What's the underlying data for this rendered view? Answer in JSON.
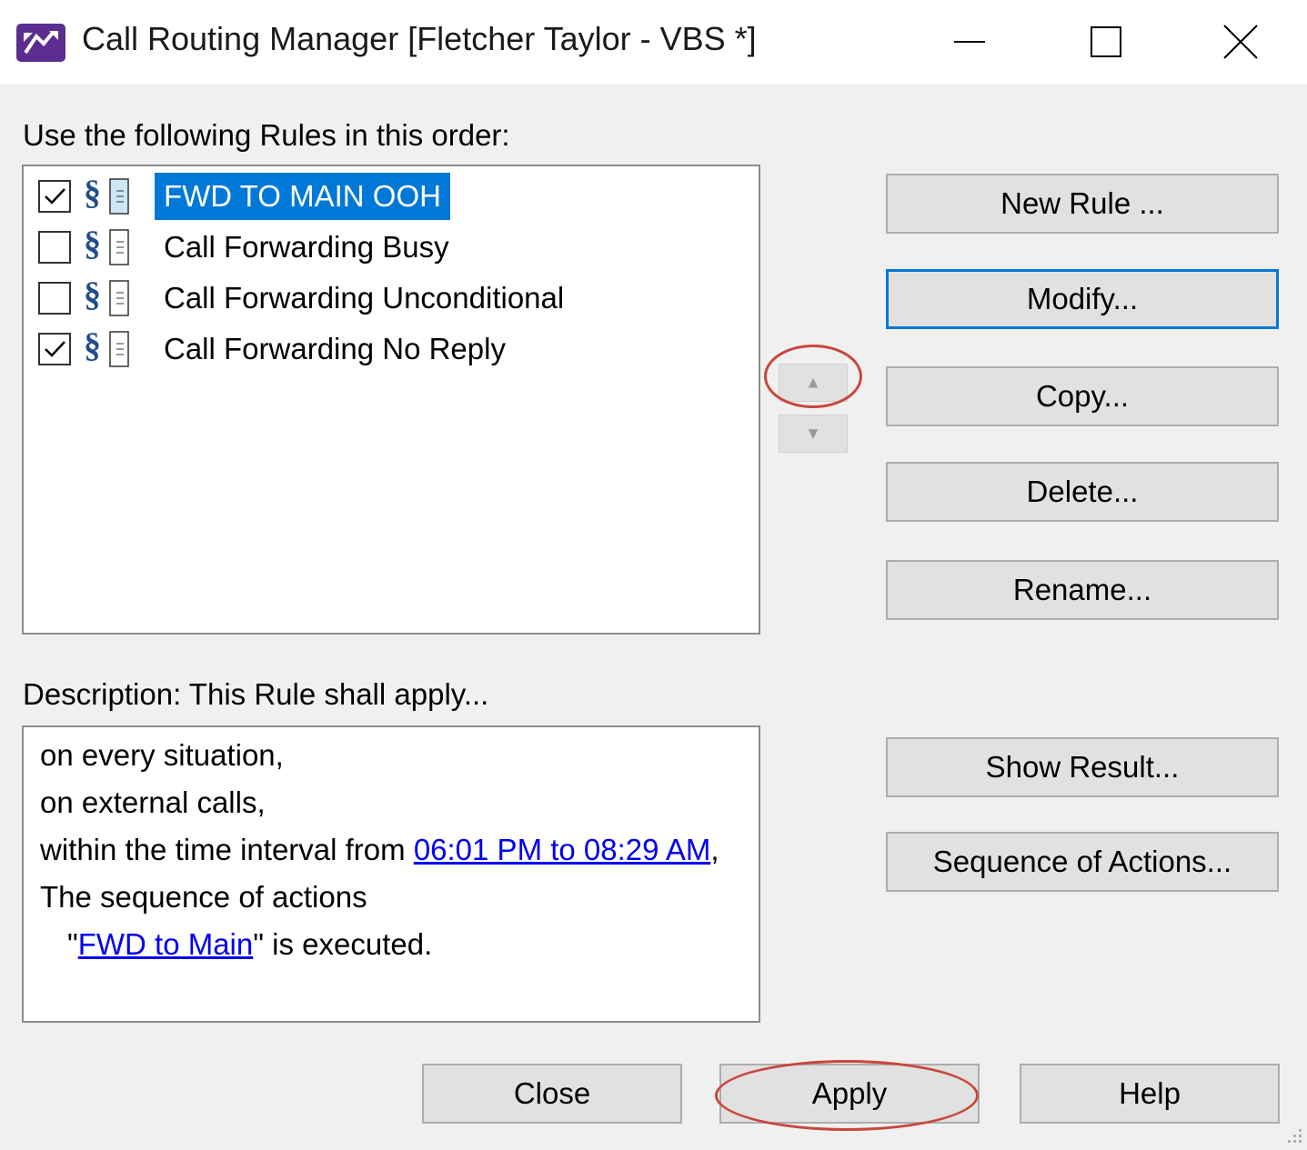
{
  "window": {
    "title": "Call Routing Manager [Fletcher Taylor - VBS *]",
    "accent": "#0078d7",
    "icon_color": "#5b2d8e"
  },
  "rules_section": {
    "label": "Use the following Rules in this order:",
    "rules": [
      {
        "label": "FWD TO MAIN OOH",
        "checked": true,
        "selected": true
      },
      {
        "label": "Call Forwarding Busy",
        "checked": false,
        "selected": false
      },
      {
        "label": "Call Forwarding Unconditional",
        "checked": false,
        "selected": false
      },
      {
        "label": "Call Forwarding No Reply",
        "checked": true,
        "selected": false
      }
    ],
    "rule_icon": "§"
  },
  "side_buttons": {
    "new_rule": "New Rule ...",
    "modify": "Modify...",
    "copy": "Copy...",
    "delete": "Delete...",
    "rename": "Rename...",
    "show_result": "Show Result...",
    "sequence_of_actions": "Sequence of Actions..."
  },
  "move_buttons": {
    "up_icon": "triangle-up-icon",
    "down_icon": "triangle-down-icon"
  },
  "description": {
    "label": "Description: This Rule shall apply...",
    "line1": "on every situation,",
    "line2": "on external calls,",
    "line3_prefix": "within the time interval from ",
    "line3_link": "06:01 PM to 08:29 AM",
    "line3_suffix": ",",
    "line4": "The sequence of actions",
    "line5_prefix": "\"",
    "line5_link": "FWD to Main",
    "line5_suffix": "\" is executed."
  },
  "footer": {
    "close": "Close",
    "apply": "Apply",
    "help": "Help"
  },
  "annotations": {
    "highlight_color": "#c9473c"
  }
}
